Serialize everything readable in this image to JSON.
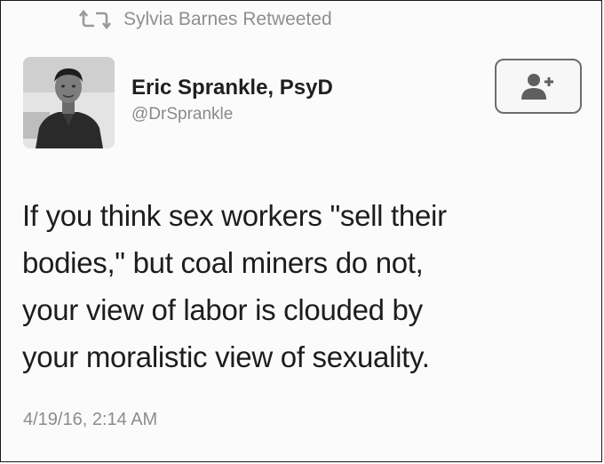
{
  "retweet": {
    "icon": "retweet-icon",
    "text": "Sylvia Barnes Retweeted"
  },
  "author": {
    "name": "Eric Sprankle, PsyD",
    "handle": "@DrSprankle",
    "avatar_icon": "avatar-photo"
  },
  "follow_button": {
    "icon": "follow-user-plus-icon"
  },
  "tweet": {
    "lines": [
      "If you think sex workers \"sell their",
      "bodies,\" but coal miners do not,",
      "your view of labor is clouded by",
      "your moralistic view of sexuality."
    ],
    "timestamp": "4/19/16, 2:14 AM"
  },
  "colors": {
    "text": "#1d1d1d",
    "muted": "#8c8c8c",
    "background": "#fbfbfb"
  }
}
